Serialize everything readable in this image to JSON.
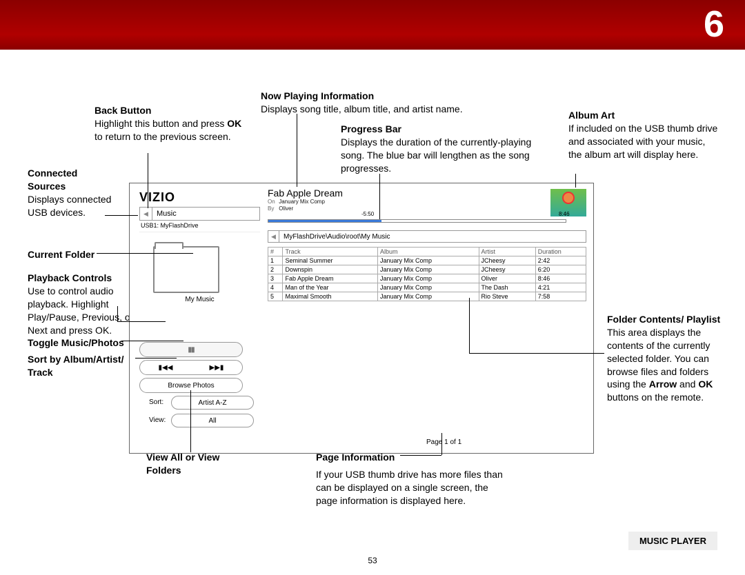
{
  "chapter_number": "6",
  "page_number": "53",
  "footer_label": "MUSIC PLAYER",
  "callouts": {
    "back_button": {
      "title": "Back Button",
      "body": "Highlight this button and press OK to return to the previous screen."
    },
    "connected_sources": {
      "title": "Connected Sources",
      "body": "Displays connected USB devices."
    },
    "current_folder": {
      "title": "Current Folder"
    },
    "playback_controls": {
      "title": "Playback Controls",
      "body": "Use to control audio playback. Highlight Play/Pause, Previous, or Next and press OK."
    },
    "toggle": {
      "title": "Toggle Music/Photos"
    },
    "sort": {
      "title": "Sort by Album/Artist/ Track"
    },
    "view_all": {
      "title": "View All or View Folders"
    },
    "now_playing": {
      "title": "Now Playing Information",
      "body": "Displays song title, album title, and artist name."
    },
    "progress_bar": {
      "title": "Progress Bar",
      "body": "Displays the duration of the currently-playing song. The blue bar will lengthen as the song progresses."
    },
    "page_info": {
      "title": "Page Information",
      "body": "If your USB thumb drive has more files than can be displayed on a single screen, the page information is displayed here."
    },
    "album_art": {
      "title": "Album Art",
      "body": "If included on the USB thumb drive and associated with your music, the album art will display here."
    },
    "folder_contents": {
      "title": "Folder Contents/ Playlist",
      "body1": "This area displays the contents of the currently selected folder. You can browse files and folders using the ",
      "arrowok": "Arrow",
      "and": " and ",
      "okword": "OK",
      "body2": " buttons on the remote."
    }
  },
  "player": {
    "logo": "VIZIO",
    "music_label": "Music",
    "source_line": "USB1: MyFlashDrive",
    "folder_name": "My Music",
    "browse_photos": "Browse Photos",
    "sort_label": "Sort:",
    "sort_value": "Artist A-Z",
    "view_label": "View:",
    "view_value": "All",
    "now_playing": {
      "title": "Fab Apple Dream",
      "on_label": "On",
      "on_value": "January Mix Comp",
      "by_label": "By",
      "by_value": "Oliver"
    },
    "time_left": "-5:50",
    "time_total": "8:46",
    "breadcrumb": "MyFlashDrive\\Audio\\root\\My Music",
    "headers": [
      "#",
      "Track",
      "Album",
      "Artist",
      "Duration"
    ],
    "rows": [
      [
        "1",
        "Seminal Summer",
        "January Mix Comp",
        "JCheesy",
        "2:42"
      ],
      [
        "2",
        "Downspin",
        "January Mix Comp",
        "JCheesy",
        "6:20"
      ],
      [
        "3",
        "Fab Apple Dream",
        "January Mix Comp",
        "Oliver",
        "8:46"
      ],
      [
        "4",
        "Man of the Year",
        "January Mix Comp",
        "The Dash",
        "4:21"
      ],
      [
        "5",
        "Maximal Smooth",
        "January Mix Comp",
        "Rio Steve",
        "7:58"
      ]
    ],
    "page_info": "Page 1 of 1"
  }
}
